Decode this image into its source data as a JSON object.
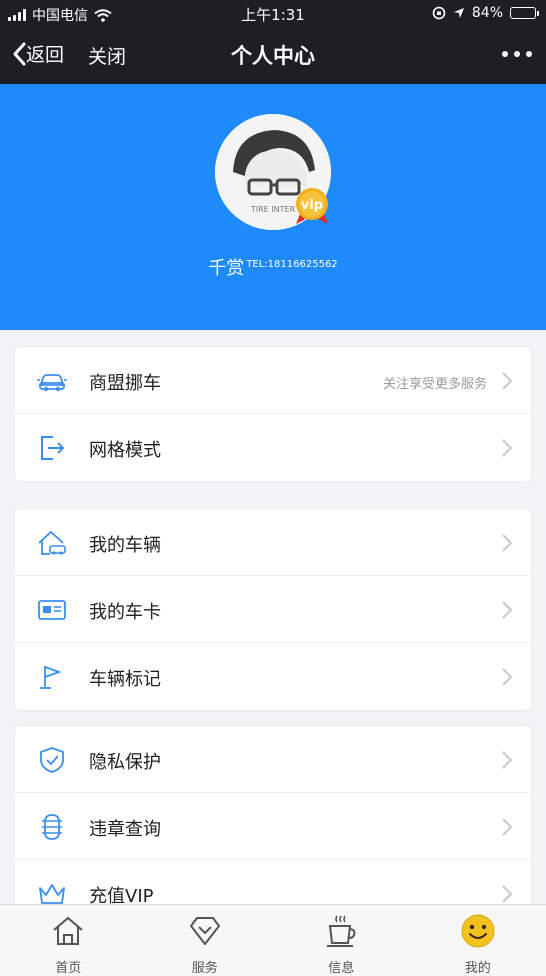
{
  "status_bar": {
    "carrier": "中国电信",
    "time": "上午1:31",
    "battery": "84%",
    "battery_level": 0.84
  },
  "nav": {
    "back_label": "返回",
    "close_label": "关闭",
    "title": "个人中心",
    "more_icon": "more-icon"
  },
  "profile": {
    "name": "千赏",
    "tel": "TEL:18116625562",
    "avatar_text": "TIRE INTER",
    "vip_badge_text": "vip",
    "header_color": "#1f8afc"
  },
  "groups": [
    {
      "items": [
        {
          "label": "商盟挪车",
          "hint": "关注享受更多服务",
          "icon": "car-move-icon"
        },
        {
          "label": "网格模式",
          "hint": "",
          "icon": "exit-icon"
        }
      ]
    },
    {
      "items": [
        {
          "label": "我的车辆",
          "hint": "",
          "icon": "car-home-icon"
        },
        {
          "label": "我的车卡",
          "hint": "",
          "icon": "card-icon"
        },
        {
          "label": "车辆标记",
          "hint": "",
          "icon": "flag-icon"
        }
      ]
    },
    {
      "items": [
        {
          "label": "隐私保护",
          "hint": "",
          "icon": "shield-icon"
        },
        {
          "label": "违章查询",
          "hint": "",
          "icon": "tire-icon"
        },
        {
          "label": "充值VIP",
          "hint": "",
          "icon": "crown-icon"
        }
      ]
    }
  ],
  "tabs": [
    {
      "label": "首页",
      "icon": "home-icon",
      "active": false
    },
    {
      "label": "服务",
      "icon": "diamond-icon",
      "active": false
    },
    {
      "label": "信息",
      "icon": "coffee-icon",
      "active": false
    },
    {
      "label": "我的",
      "icon": "smiley-icon",
      "active": true
    }
  ],
  "colors": {
    "accent_blue": "#1f8afc",
    "icon_blue": "#3b8ef0",
    "active_tab": "#f4c21e"
  }
}
